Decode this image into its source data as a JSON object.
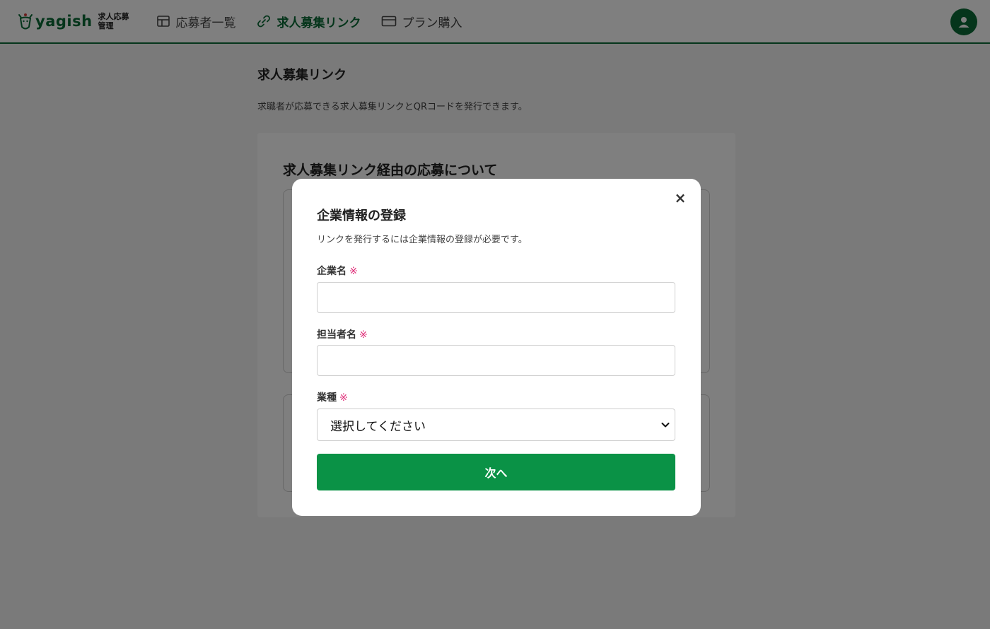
{
  "header": {
    "logo_text": "yagish",
    "logo_sub": "求人応募\n管理",
    "nav": [
      {
        "label": "応募者一覧",
        "icon": "table-icon"
      },
      {
        "label": "求人募集リンク",
        "icon": "link-icon",
        "active": true
      },
      {
        "label": "プラン購入",
        "icon": "card-icon"
      }
    ],
    "avatar_icon": "user-icon"
  },
  "page": {
    "title": "求人募集リンク",
    "description": "求職者が応募できる求人募集リンクとQRコードを発行できます。",
    "card_title": "求人募集リンク経由の応募について"
  },
  "modal": {
    "close_label": "×",
    "title": "企業情報の登録",
    "description": "リンクを発行するには企業情報の登録が必要です。",
    "required_mark": "※",
    "fields": {
      "company_name": {
        "label": "企業名",
        "value": ""
      },
      "contact_name": {
        "label": "担当者名",
        "value": ""
      },
      "industry": {
        "label": "業種",
        "selected": "選択してください"
      }
    },
    "submit_label": "次へ"
  },
  "colors": {
    "brand": "#0b6b36",
    "button": "#0a9246",
    "required": "#e0307a"
  }
}
